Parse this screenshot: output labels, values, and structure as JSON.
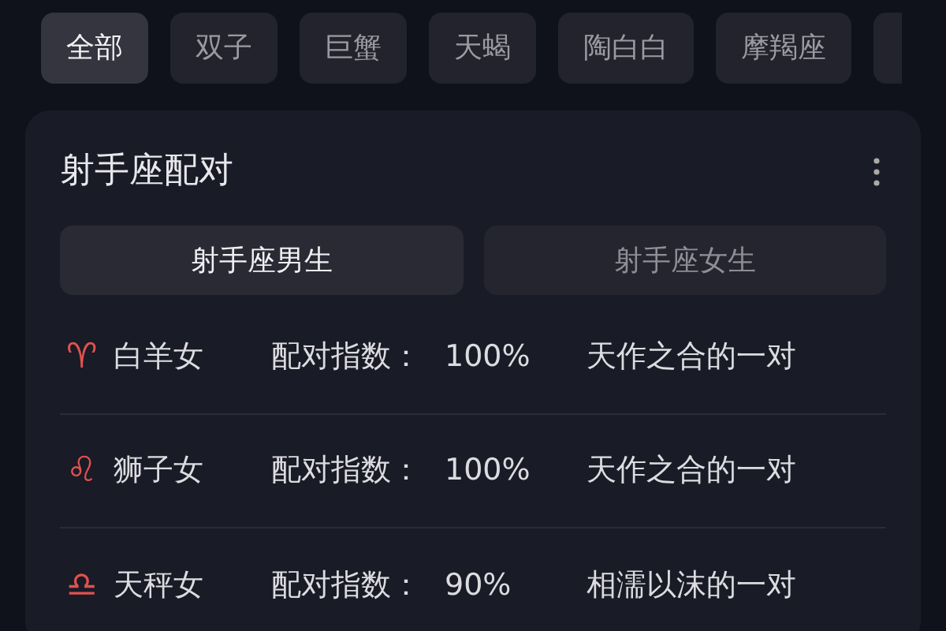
{
  "filter_tabs": [
    {
      "label": "全部",
      "selected": true
    },
    {
      "label": "双子",
      "selected": false
    },
    {
      "label": "巨蟹",
      "selected": false
    },
    {
      "label": "天蝎",
      "selected": false
    },
    {
      "label": "陶白白",
      "selected": false
    },
    {
      "label": "摩羯座",
      "selected": false
    }
  ],
  "card": {
    "title": "射手座配对",
    "gender_toggle": [
      {
        "label": "射手座男生",
        "selected": true
      },
      {
        "label": "射手座女生",
        "selected": false
      }
    ],
    "matches": [
      {
        "symbol": "♈",
        "name": "白羊女",
        "index_label": "配对指数：",
        "index_value": "100%",
        "description": "天作之合的一对"
      },
      {
        "symbol": "♌",
        "name": "狮子女",
        "index_label": "配对指数：",
        "index_value": "100%",
        "description": "天作之合的一对"
      },
      {
        "symbol": "♎",
        "name": "天秤女",
        "index_label": "配对指数：",
        "index_value": "90%",
        "description": "相濡以沫的一对"
      }
    ]
  }
}
